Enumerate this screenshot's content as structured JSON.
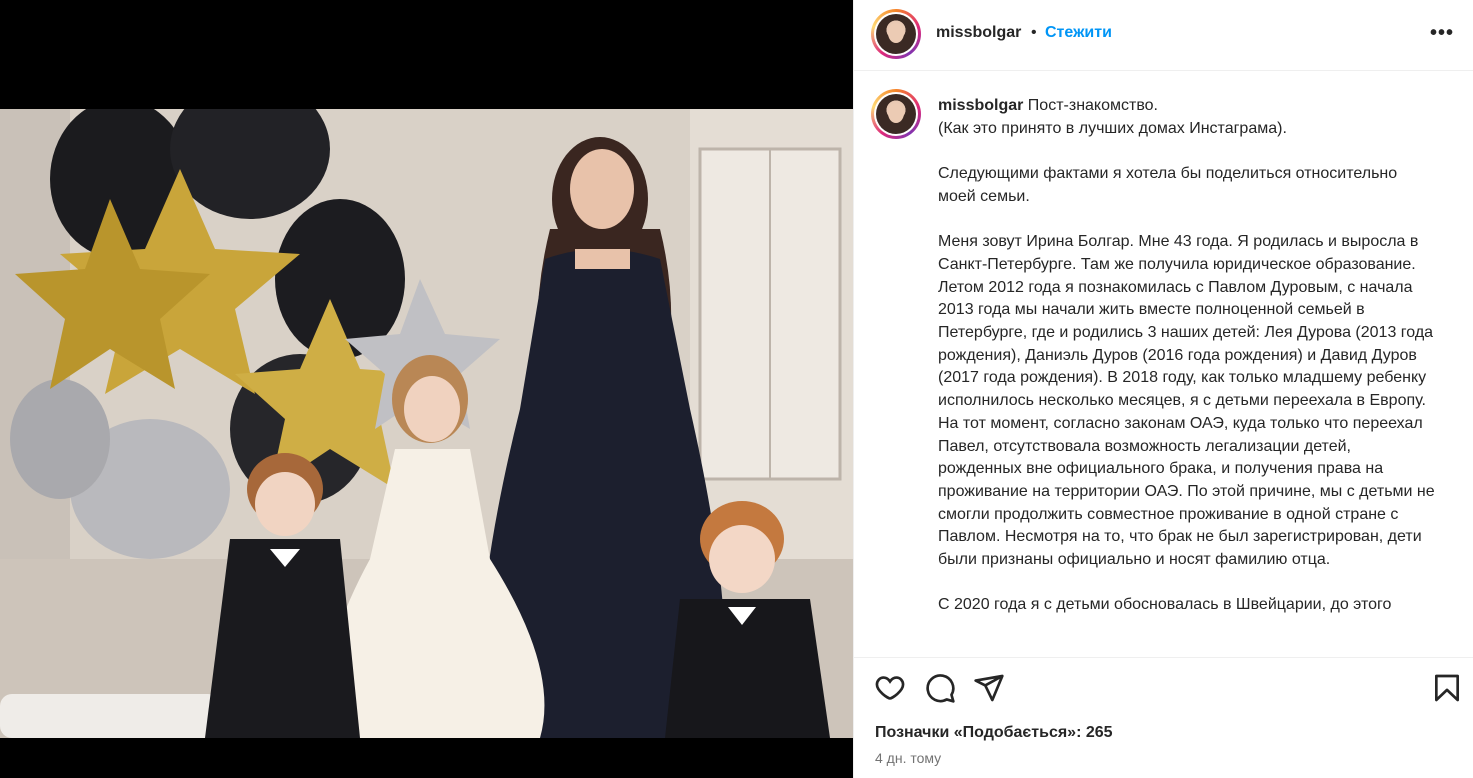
{
  "post": {
    "username": "missbolgar",
    "separator": "•",
    "follow_label": "Стежити",
    "more_label": "•••"
  },
  "caption": {
    "username": "missbolgar",
    "text": " Пост-знакомство.\n(Как это принято в лучших домах Инстаграма).\n\nСледующими фактами я хотела бы поделиться относительно моей семьи.\n\nМеня зовут Ирина Болгар. Мне 43 года. Я родилась и выросла в Санкт-Петербурге. Там же получила юридическое образование.\nЛетом 2012 года я познакомилась с Павлом Дуровым, с начала 2013 года мы начали жить вместе полноценной семьей в Петербурге, где и родились 3 наших детей: Лея Дурова (2013 года рождения), Даниэль Дуров (2016 года рождения) и Давид Дуров (2017 года рождения). В 2018 году, как только младшему ребенку исполнилось несколько месяцев, я с детьми переехала в Европу. На тот момент, согласно законам ОАЭ, куда только что переехал Павел, отсутствовала возможность легализации детей, рожденных вне официального брака, и получения права на проживание на территории ОАЭ. По этой причине, мы с детьми не смогли продолжить совместное проживание в одной стране с Павлом. Несмотря на то, что брак не был зарегистрирован, дети были признаны официально и носят фамилию отца.\n\nС 2020 года я с детьми обосновалась в Швейцарии, до этого"
  },
  "stats": {
    "likes_text": "Позначки «Подобається»: 265",
    "time_text": "4 дн. тому"
  },
  "icons": {
    "like": "heart-icon",
    "comment": "comment-icon",
    "share": "share-icon",
    "save": "bookmark-icon"
  }
}
